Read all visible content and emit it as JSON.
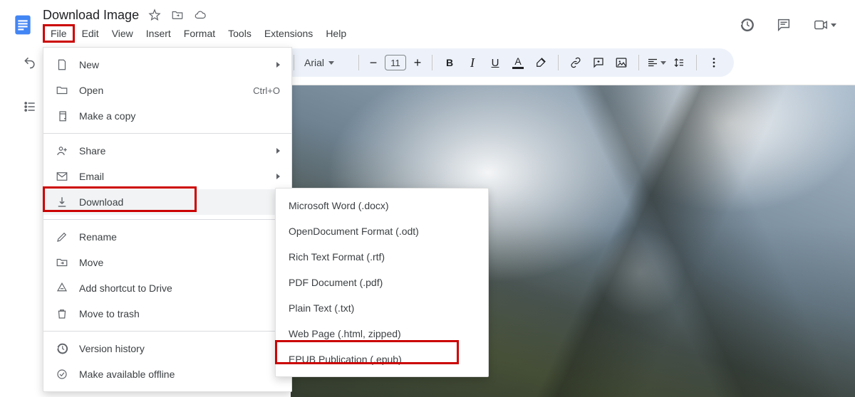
{
  "doc": {
    "title": "Download Image"
  },
  "menubar": {
    "file": "File",
    "edit": "Edit",
    "view": "View",
    "insert": "Insert",
    "format": "Format",
    "tools": "Tools",
    "extensions": "Extensions",
    "help": "Help"
  },
  "toolbar": {
    "font_name": "Arial",
    "font_size": "11",
    "bold": "B",
    "italic": "I",
    "underline": "U",
    "textcolor_letter": "A"
  },
  "file_menu": {
    "new": {
      "label": "New"
    },
    "open": {
      "label": "Open",
      "shortcut": "Ctrl+O"
    },
    "make_copy": {
      "label": "Make a copy"
    },
    "share": {
      "label": "Share"
    },
    "email": {
      "label": "Email"
    },
    "download": {
      "label": "Download"
    },
    "rename": {
      "label": "Rename"
    },
    "move": {
      "label": "Move"
    },
    "add_shortcut": {
      "label": "Add shortcut to Drive"
    },
    "move_to_trash": {
      "label": "Move to trash"
    },
    "version_history": {
      "label": "Version history"
    },
    "available_offline": {
      "label": "Make available offline"
    }
  },
  "download_menu": {
    "docx": "Microsoft Word (.docx)",
    "odt": "OpenDocument Format (.odt)",
    "rtf": "Rich Text Format (.rtf)",
    "pdf": "PDF Document (.pdf)",
    "txt": "Plain Text (.txt)",
    "html": "Web Page (.html, zipped)",
    "epub": "EPUB Publication (.epub)"
  }
}
